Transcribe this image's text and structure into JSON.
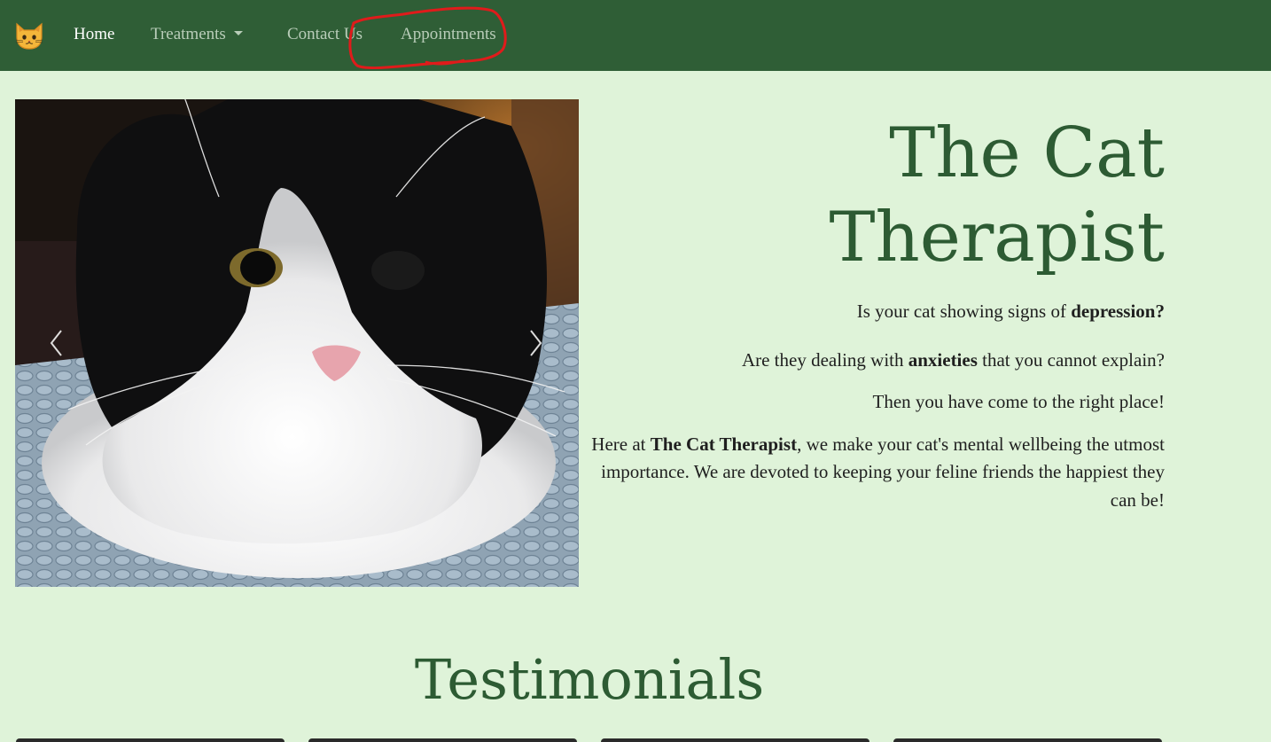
{
  "nav": {
    "brand_icon": "cat-face-icon",
    "items": [
      {
        "label": "Home",
        "active": true
      },
      {
        "label": "Treatments",
        "dropdown": true
      },
      {
        "label": "Contact Us"
      },
      {
        "label": "Appointments"
      }
    ]
  },
  "carousel": {
    "prev_icon": "chevron-left-icon",
    "next_icon": "chevron-right-icon"
  },
  "hero": {
    "title_line1": "The Cat",
    "title_line2": "Therapist",
    "p1_text": "Is your cat showing signs of ",
    "p1_bold": "depression?",
    "p2_pre": "Are they dealing with ",
    "p2_bold": "anxieties",
    "p2_post": " that you cannot explain?",
    "p3": "Then you have come to the right place!",
    "p4_pre": "Here at ",
    "p4_bold": "The Cat Therapist",
    "p4_post": ", we make your cat's mental wellbeing the utmost importance. We are devoted to keeping your feline friends the happiest they can be!"
  },
  "testimonials": {
    "title": "Testimonials"
  },
  "colors": {
    "navbar": "#2f5e36",
    "page_bg": "#dff3d9",
    "heading_green": "#2d5b33",
    "annotation_red": "#e01b1b"
  }
}
